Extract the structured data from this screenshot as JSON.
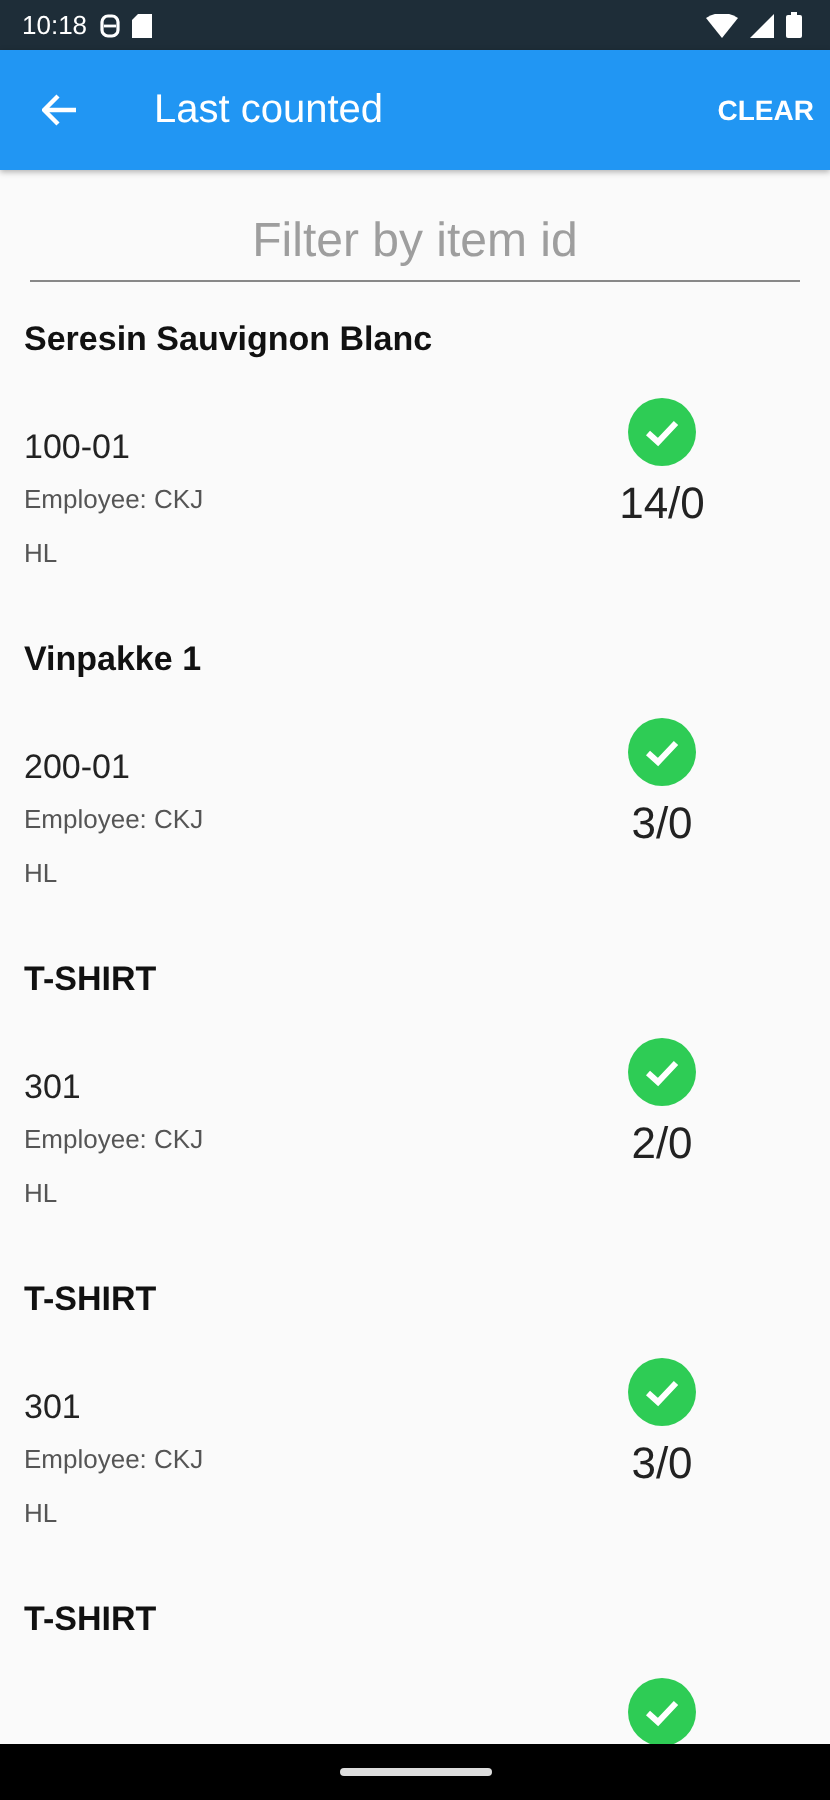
{
  "status_bar": {
    "time": "10:18"
  },
  "app_bar": {
    "title": "Last counted",
    "action": "CLEAR"
  },
  "filter": {
    "placeholder": "Filter by item id"
  },
  "items": [
    {
      "name": "Seresin Sauvignon Blanc",
      "item_id": "100-01",
      "employee": "Employee: CKJ",
      "extra": "HL",
      "count": "14/0",
      "verified": true
    },
    {
      "name": "Vinpakke 1",
      "item_id": "200-01",
      "employee": "Employee: CKJ",
      "extra": "HL",
      "count": "3/0",
      "verified": true
    },
    {
      "name": "T-SHIRT",
      "item_id": "301",
      "employee": "Employee: CKJ",
      "extra": "HL",
      "count": "2/0",
      "verified": true
    },
    {
      "name": "T-SHIRT",
      "item_id": "301",
      "employee": "Employee: CKJ",
      "extra": "HL",
      "count": "3/0",
      "verified": true
    },
    {
      "name": "T-SHIRT",
      "verified": true
    }
  ]
}
